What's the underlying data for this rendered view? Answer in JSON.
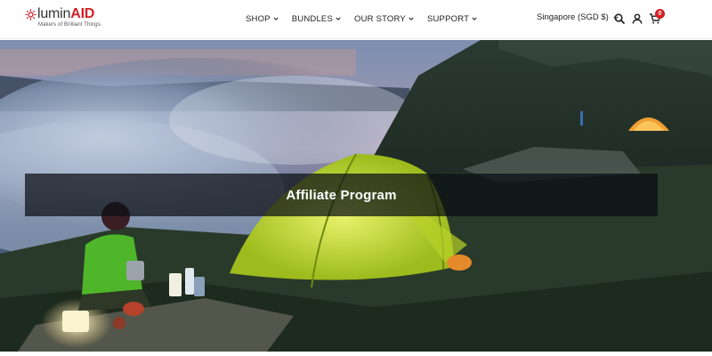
{
  "brand": {
    "name_part1": "lumin",
    "name_part2": "AID",
    "tagline": "Makers of Brilliant Things.",
    "accent_color": "#d32027"
  },
  "nav": {
    "items": [
      {
        "label": "SHOP",
        "icon": "chevron-down-icon"
      },
      {
        "label": "BUNDLES",
        "icon": "chevron-down-icon"
      },
      {
        "label": "OUR STORY",
        "icon": "chevron-down-icon"
      },
      {
        "label": "SUPPORT",
        "icon": "chevron-down-icon"
      }
    ]
  },
  "header_tools": {
    "currency": "Singapore (SGD $)",
    "currency_icon": "chevron-down-icon",
    "search_icon": "search-icon",
    "account_icon": "user-icon",
    "cart_icon": "cart-icon",
    "cart_count": "0"
  },
  "hero": {
    "title": "Affiliate Program"
  }
}
